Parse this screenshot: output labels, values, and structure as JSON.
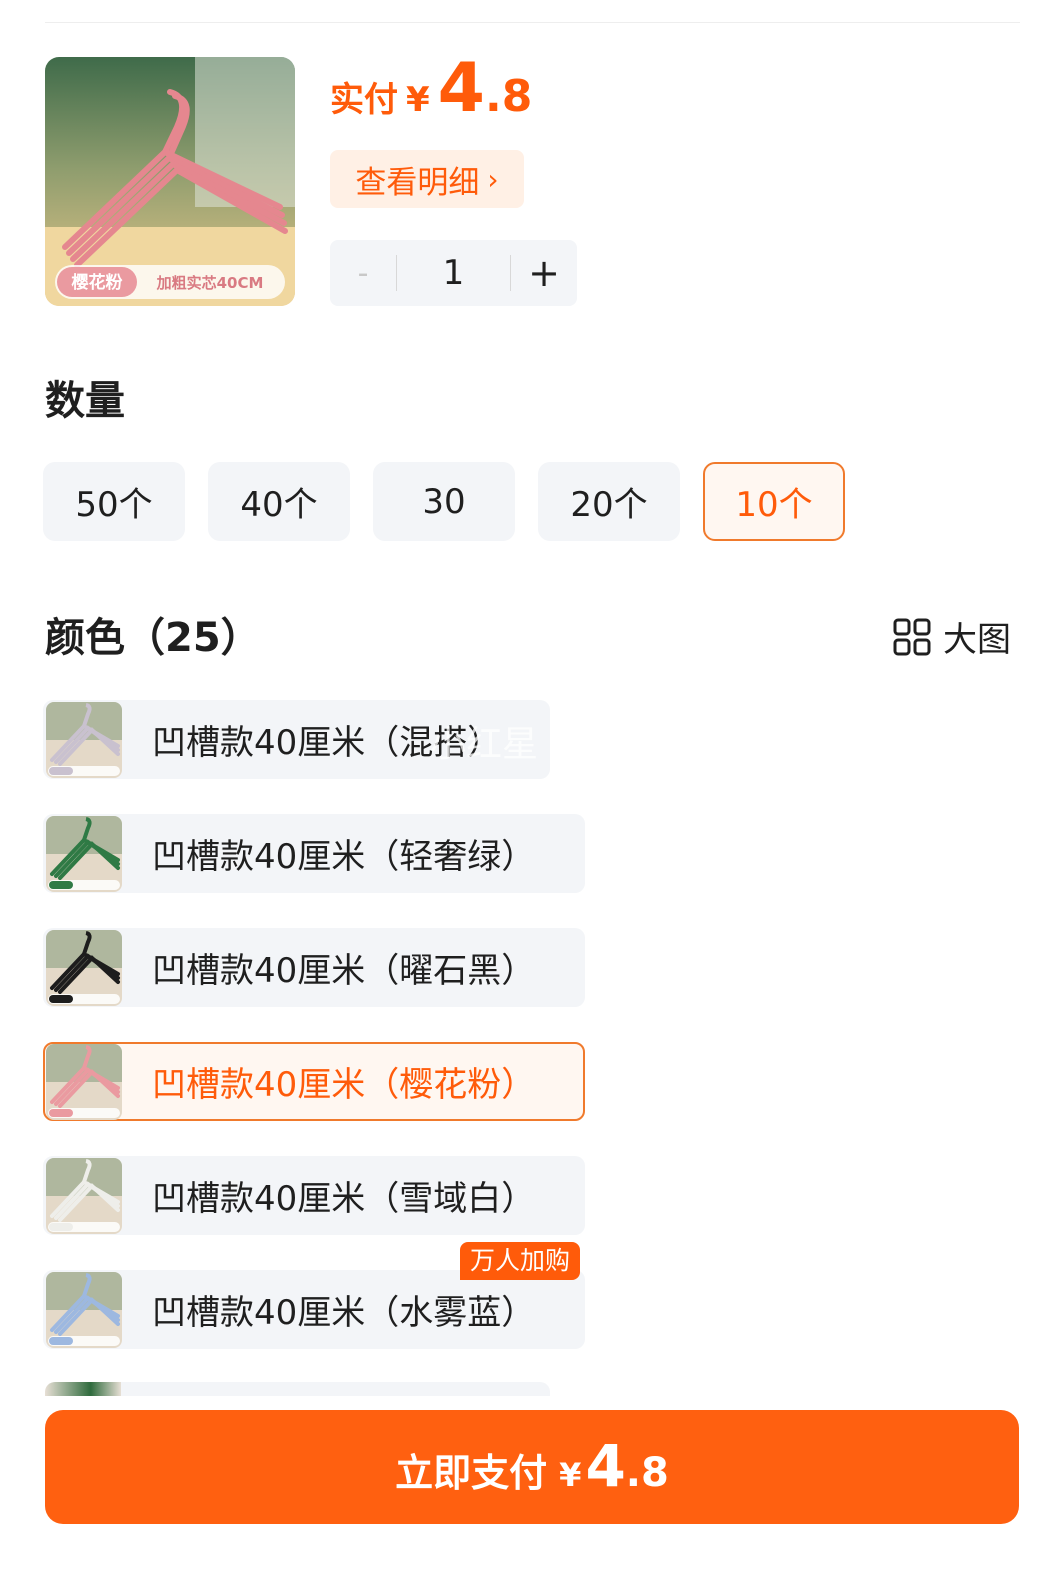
{
  "product": {
    "thumb_tags": [
      "樱花粉",
      "加粗实芯40CM"
    ],
    "price_label": "实付",
    "price_symbol": "¥",
    "price_int": "4",
    "price_dec": ".8",
    "detail_button": "查看明细",
    "quantity": "1",
    "minus": "-",
    "plus": "+"
  },
  "quantity_section": {
    "title": "数量",
    "options": [
      "50个",
      "40个",
      "30",
      "20个",
      "10个"
    ],
    "selected_index": 4
  },
  "color_section": {
    "title": "颜色（25）",
    "big_view_label": "大图",
    "watermark": "小红星",
    "options": [
      {
        "label": "凹槽款40厘米（混搭）",
        "swatch": "#c9c1cf",
        "tag": "混搭"
      },
      {
        "label": "凹槽款40厘米（轻奢绿）",
        "swatch": "#2f7a45",
        "tag": "轻奢绿"
      },
      {
        "label": "凹槽款40厘米（曜石黑）",
        "swatch": "#1d1d1d",
        "tag": "曜石黑"
      },
      {
        "label": "凹槽款40厘米（樱花粉）",
        "swatch": "#ea9aa0",
        "tag": "樱花粉"
      },
      {
        "label": "凹槽款40厘米（雪域白）",
        "swatch": "#eeeeea",
        "tag": "雪域白"
      },
      {
        "label": "凹槽款40厘米（水雾蓝）",
        "swatch": "#9db8e0",
        "tag": "水雾蓝",
        "badge": "万人加购"
      }
    ],
    "selected_index": 3
  },
  "pay_button": {
    "label": "立即支付",
    "symbol": "¥",
    "price_int": "4",
    "price_dec": ".8"
  },
  "colors": {
    "accent": "#ff5b0a",
    "button": "#ff6010",
    "option_bg": "#f3f5f8",
    "selected_border": "#f07a2c"
  }
}
